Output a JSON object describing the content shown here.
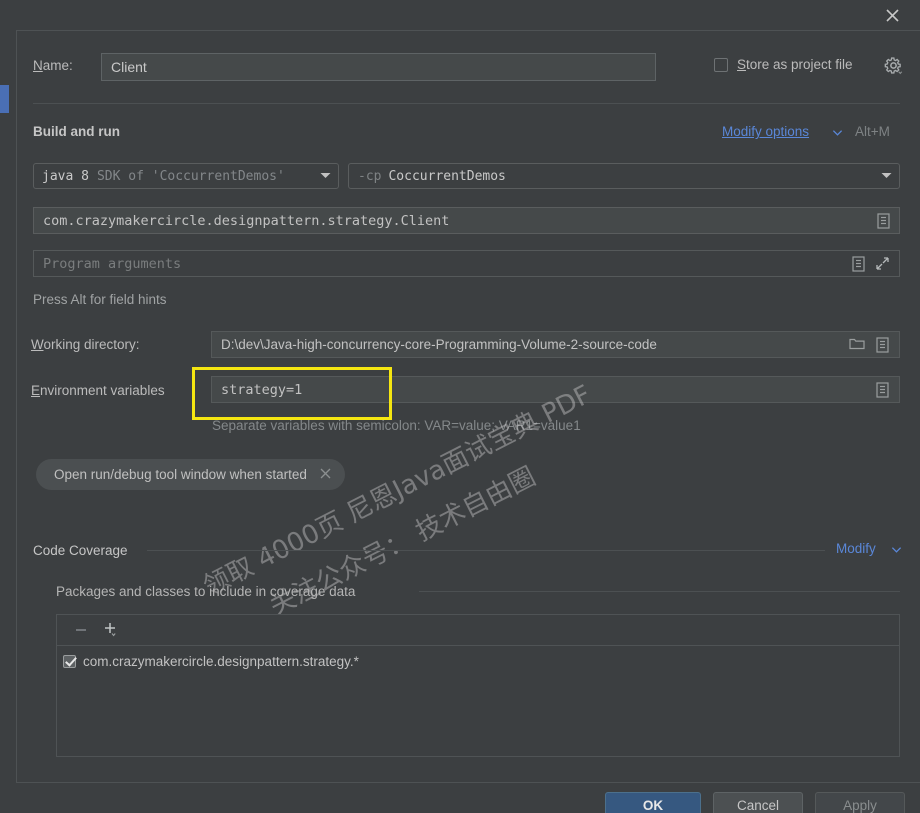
{
  "window": {
    "close_icon": "close-icon"
  },
  "name_row": {
    "label": "Name:",
    "value": "Client",
    "store_as_project_file": "Store as project file",
    "store_checked": false,
    "gear_icon": "gear-icon"
  },
  "build_and_run": {
    "section_title": "Build and run",
    "modify_options": "Modify options",
    "modify_options_shortcut": "Alt+M",
    "jdk": {
      "primary": "java 8",
      "secondary": "SDK of 'CoccurrentDemos'"
    },
    "classpath": {
      "flag": "-cp",
      "value": "CoccurrentDemos"
    },
    "main_class": "com.crazymakercircle.designpattern.strategy.Client",
    "program_arguments_placeholder": "Program arguments",
    "program_arguments_value": "",
    "field_hint": "Press Alt for field hints"
  },
  "working_directory": {
    "label": "Working directory:",
    "value": "D:\\dev\\Java-high-concurrency-core-Programming-Volume-2-source-code",
    "browse_icon": "folder-icon",
    "expand_icon": "insert-macro-icon"
  },
  "environment_variables": {
    "label": "Environment variables",
    "value": "strategy=1",
    "hint": "Separate variables with semicolon: VAR=value; VAR1=value1",
    "highlight_color": "#f5e611",
    "edit_icon": "insert-macro-icon"
  },
  "chip": {
    "label": "Open run/debug tool window when started",
    "remove_icon": "close-icon"
  },
  "code_coverage": {
    "section_title": "Code Coverage",
    "modify_label": "Modify",
    "packages_title": "Packages and classes to include in coverage data",
    "toolbar": {
      "remove_icon": "minus-icon",
      "add_icon": "plus-dropdown-icon"
    },
    "rows": [
      {
        "checked": true,
        "pattern": "com.crazymakercircle.designpattern.strategy.*"
      }
    ]
  },
  "footer": {
    "ok": "OK",
    "cancel": "Cancel",
    "apply": "Apply",
    "ok_color": "#365880"
  },
  "watermark": {
    "line1": "领取 4000页 尼恩Java面试宝典 PDF",
    "line2": "关注公众号： 技术自由圈"
  }
}
